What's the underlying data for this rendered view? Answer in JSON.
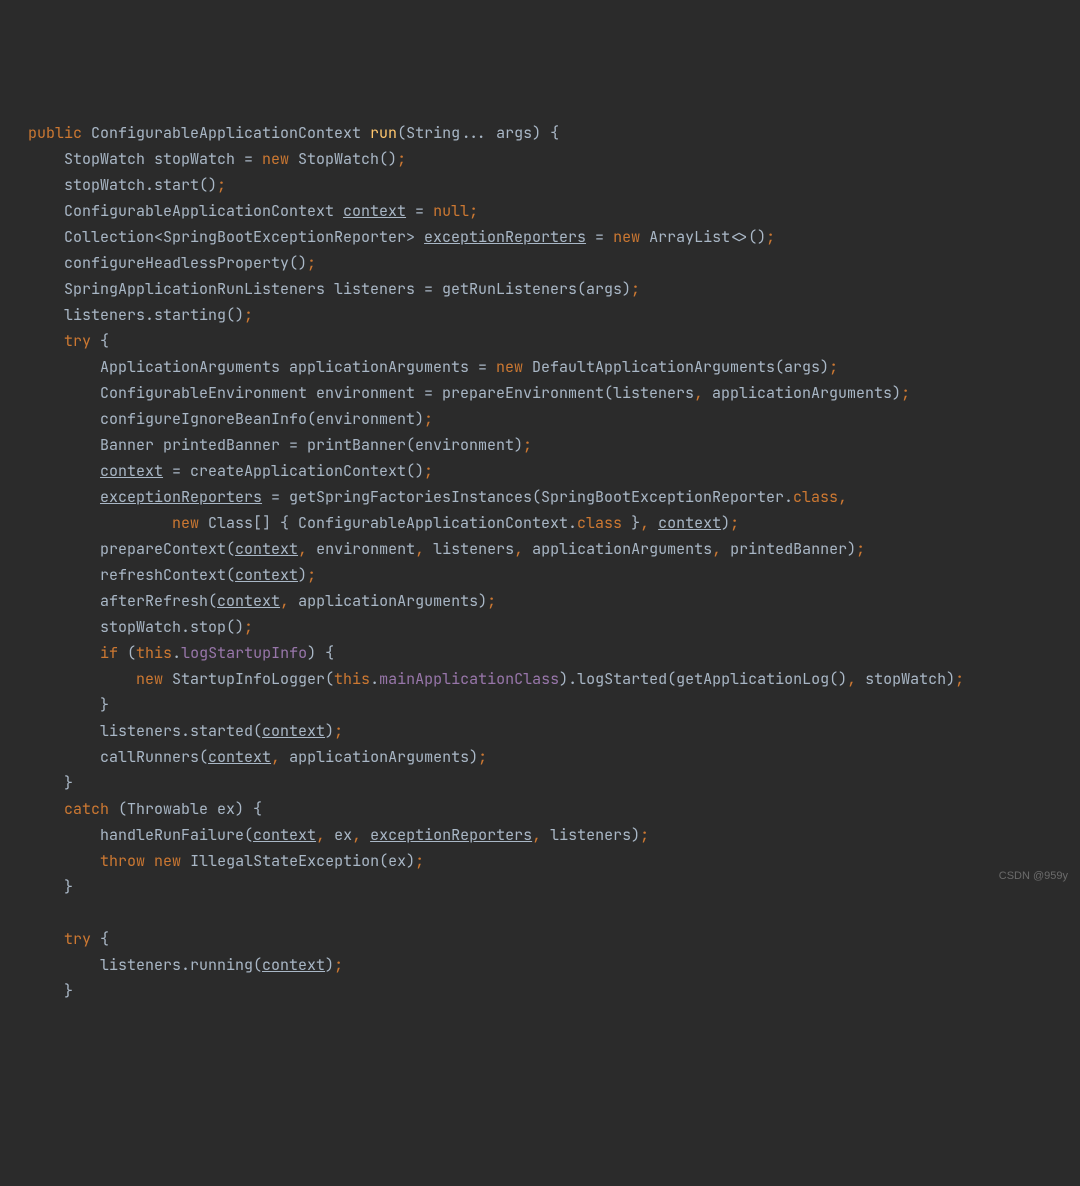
{
  "watermark": "CSDN @959y",
  "code": {
    "l1": {
      "kw_public": "public",
      "sp1": " ",
      "type": "ConfigurableApplicationContext ",
      "mname": "run",
      "sig": "(String... args) {"
    },
    "l2": {
      "indent": "    ",
      "t1": "StopWatch stopWatch = ",
      "kw_new": "new",
      "t2": " StopWatch()",
      "semi": ";"
    },
    "l3": {
      "indent": "    ",
      "t1": "stopWatch.start()",
      "semi": ";"
    },
    "l4": {
      "indent": "    ",
      "t1": "ConfigurableApplicationContext ",
      "var": "context",
      "t2": " = ",
      "kw": "null",
      "semi": ";"
    },
    "l5": {
      "indent": "    ",
      "t1": "Collection<SpringBootExceptionReporter> ",
      "var": "exceptionReporters",
      "t2": " = ",
      "kw_new": "new",
      "t3": " ArrayList<>()",
      "semi": ";"
    },
    "l6": {
      "indent": "    ",
      "t1": "configureHeadlessProperty()",
      "semi": ";"
    },
    "l7": {
      "indent": "    ",
      "t1": "SpringApplicationRunListeners listeners = getRunListeners(args)",
      "semi": ";"
    },
    "l8": {
      "indent": "    ",
      "t1": "listeners.starting()",
      "semi": ";"
    },
    "l9": {
      "indent": "    ",
      "kw": "try",
      "t1": " {"
    },
    "l10": {
      "indent": "        ",
      "t1": "ApplicationArguments applicationArguments = ",
      "kw_new": "new",
      "t2": " DefaultApplicationArguments(args)",
      "semi": ";"
    },
    "l11": {
      "indent": "        ",
      "t1": "ConfigurableEnvironment environment = prepareEnvironment(listeners",
      "c1": ",",
      "t2": " applicationArguments)",
      "semi": ";"
    },
    "l12": {
      "indent": "        ",
      "t1": "configureIgnoreBeanInfo(environment)",
      "semi": ";"
    },
    "l13": {
      "indent": "        ",
      "t1": "Banner printedBanner = printBanner(environment)",
      "semi": ";"
    },
    "l14": {
      "indent": "        ",
      "var": "context",
      "t1": " = createApplicationContext()",
      "semi": ";"
    },
    "l15": {
      "indent": "        ",
      "var": "exceptionReporters",
      "t1": " = getSpringFactoriesInstances(SpringBootExceptionReporter.",
      "kw_class": "class",
      "c1": ","
    },
    "l16": {
      "indent": "                ",
      "kw_new": "new",
      "t1": " Class[] { ConfigurableApplicationContext.",
      "kw_class": "class",
      "t2": " }",
      "c1": ",",
      "sp": " ",
      "var": "context",
      "t3": ")",
      "semi": ";"
    },
    "l17": {
      "indent": "        ",
      "t1": "prepareContext(",
      "var": "context",
      "c1": ",",
      "t2": " environment",
      "c2": ",",
      "t3": " listeners",
      "c3": ",",
      "t4": " applicationArguments",
      "c4": ",",
      "t5": " printedBanner)",
      "semi": ";"
    },
    "l18": {
      "indent": "        ",
      "t1": "refreshContext(",
      "var": "context",
      "t2": ")",
      "semi": ";"
    },
    "l19": {
      "indent": "        ",
      "t1": "afterRefresh(",
      "var": "context",
      "c1": ",",
      "t2": " applicationArguments)",
      "semi": ";"
    },
    "l20": {
      "indent": "        ",
      "t1": "stopWatch.stop()",
      "semi": ";"
    },
    "l21": {
      "indent": "        ",
      "kw_if": "if",
      "t1": " (",
      "kw_this": "this",
      "t2": ".",
      "field": "logStartupInfo",
      "t3": ") {"
    },
    "l22": {
      "indent": "            ",
      "kw_new": "new",
      "t1": " StartupInfoLogger(",
      "kw_this": "this",
      "t2": ".",
      "field": "mainApplicationClass",
      "t3": ").logStarted(getApplicationLog()",
      "c1": ",",
      "t4": " stopWatch)",
      "semi": ";"
    },
    "l23": {
      "indent": "        ",
      "t1": "}"
    },
    "l24": {
      "indent": "        ",
      "t1": "listeners.started(",
      "var": "context",
      "t2": ")",
      "semi": ";"
    },
    "l25": {
      "indent": "        ",
      "t1": "callRunners(",
      "var": "context",
      "c1": ",",
      "t2": " applicationArguments)",
      "semi": ";"
    },
    "l26": {
      "indent": "    ",
      "t1": "}"
    },
    "l27": {
      "indent": "    ",
      "kw": "catch",
      "t1": " (Throwable ex) {"
    },
    "l28": {
      "indent": "        ",
      "t1": "handleRunFailure(",
      "var": "context",
      "c1": ",",
      "t2": " ex",
      "c2": ",",
      "sp": " ",
      "var2": "exceptionReporters",
      "c3": ",",
      "t3": " listeners)",
      "semi": ";"
    },
    "l29": {
      "indent": "        ",
      "kw_throw": "throw",
      "sp": " ",
      "kw_new": "new",
      "t1": " IllegalStateException(ex)",
      "semi": ";"
    },
    "l30": {
      "indent": "    ",
      "t1": "}"
    },
    "l31": {
      "indent": "",
      "t1": ""
    },
    "l32": {
      "indent": "    ",
      "kw": "try",
      "t1": " {"
    },
    "l33": {
      "indent": "        ",
      "t1": "listeners.running(",
      "var": "context",
      "t2": ")",
      "semi": ";"
    },
    "l34": {
      "indent": "    ",
      "t1": "}"
    }
  }
}
